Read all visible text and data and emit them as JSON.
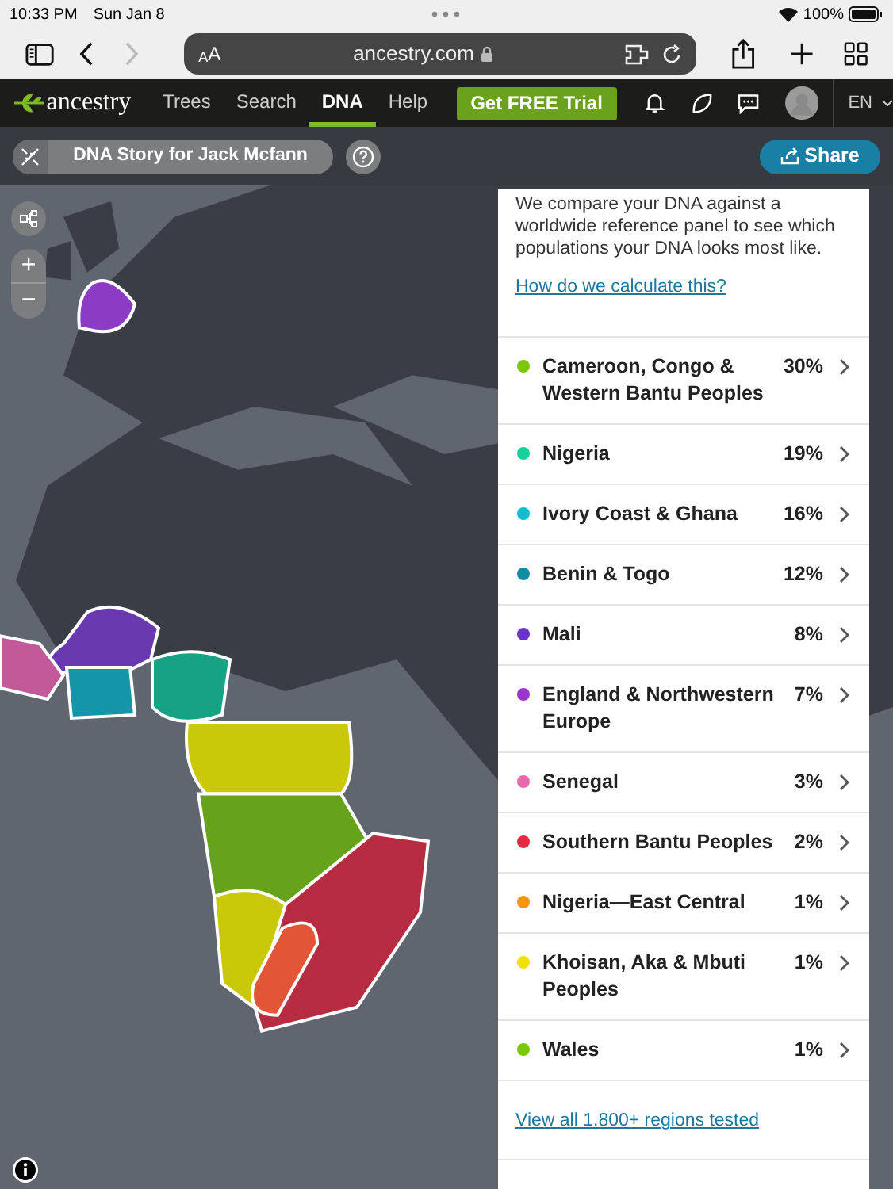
{
  "status_bar": {
    "time": "10:33 PM",
    "date": "Sun Jan 8",
    "battery": "100%"
  },
  "browser": {
    "text_size": {
      "small": "A",
      "large": "A"
    },
    "address": "ancestry.com"
  },
  "site_nav": {
    "logo": "ancestry",
    "items": [
      {
        "label": "Trees",
        "selected": false
      },
      {
        "label": "Search",
        "selected": false
      },
      {
        "label": "DNA",
        "selected": true
      },
      {
        "label": "Help",
        "selected": false
      }
    ],
    "trial_button": "Get FREE Trial",
    "language": "EN"
  },
  "subheader": {
    "story_title": "DNA Story for Jack Mcfann",
    "share": "Share"
  },
  "map_controls": {
    "zoom_in": "+",
    "zoom_out": "−"
  },
  "panel": {
    "intro": "We compare your DNA against a worldwide reference panel to see which populations your DNA looks most like.",
    "link": "How do we calculate this?",
    "regions": [
      {
        "name": "Cameroon, Congo & Western Bantu Peoples",
        "percent": "30%",
        "color": "#7ac70c"
      },
      {
        "name": "Nigeria",
        "percent": "19%",
        "color": "#1bcf9d"
      },
      {
        "name": "Ivory Coast & Ghana",
        "percent": "16%",
        "color": "#14bcd2"
      },
      {
        "name": "Benin & Togo",
        "percent": "12%",
        "color": "#128aa3"
      },
      {
        "name": "Mali",
        "percent": "8%",
        "color": "#6a35c8"
      },
      {
        "name": "England & Northwestern Europe",
        "percent": "7%",
        "color": "#9b36cc"
      },
      {
        "name": "Senegal",
        "percent": "3%",
        "color": "#e46aae"
      },
      {
        "name": "Southern Bantu Peoples",
        "percent": "2%",
        "color": "#e52a45"
      },
      {
        "name": "Nigeria—East Central",
        "percent": "1%",
        "color": "#f9940e"
      },
      {
        "name": "Khoisan, Aka & Mbuti Peoples",
        "percent": "1%",
        "color": "#f0e00c"
      },
      {
        "name": "Wales",
        "percent": "1%",
        "color": "#7ac70c"
      }
    ],
    "view_all": "View all 1,800+ regions tested"
  }
}
